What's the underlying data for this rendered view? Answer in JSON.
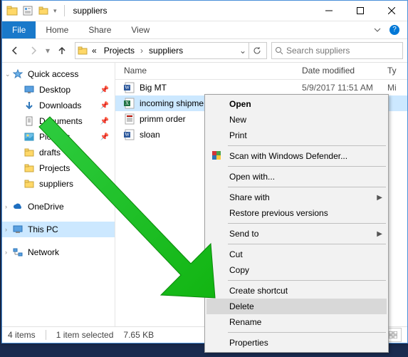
{
  "titlebar": {
    "folder": "suppliers"
  },
  "menubar": {
    "file": "File",
    "home": "Home",
    "share": "Share",
    "view": "View"
  },
  "breadcrumb": {
    "parent": "Projects",
    "current": "suppliers"
  },
  "search": {
    "placeholder": "Search suppliers"
  },
  "sidebar": {
    "quick_access": "Quick access",
    "desktop": "Desktop",
    "downloads": "Downloads",
    "documents": "Documents",
    "pictures": "Pictures",
    "drafts": "drafts",
    "projects": "Projects",
    "suppliers": "suppliers",
    "onedrive": "OneDrive",
    "this_pc": "This PC",
    "network": "Network"
  },
  "columns": {
    "name": "Name",
    "date": "Date modified",
    "type": "Ty"
  },
  "files": [
    {
      "name": "Big MT",
      "date": "5/9/2017 11:51 AM",
      "type": "Mi",
      "icon": "word"
    },
    {
      "name": "incoming shipme",
      "date": "",
      "type": "",
      "icon": "excel"
    },
    {
      "name": "primm order",
      "date": "",
      "type": "",
      "icon": "pdf"
    },
    {
      "name": "sloan",
      "date": "",
      "type": "",
      "icon": "word"
    }
  ],
  "context_menu": {
    "open": "Open",
    "new": "New",
    "print": "Print",
    "defender": "Scan with Windows Defender...",
    "open_with": "Open with...",
    "share_with": "Share with",
    "restore": "Restore previous versions",
    "send_to": "Send to",
    "cut": "Cut",
    "copy": "Copy",
    "shortcut": "Create shortcut",
    "delete": "Delete",
    "rename": "Rename",
    "properties": "Properties"
  },
  "status": {
    "count": "4 items",
    "selection": "1 item selected",
    "size": "7.65 KB"
  }
}
